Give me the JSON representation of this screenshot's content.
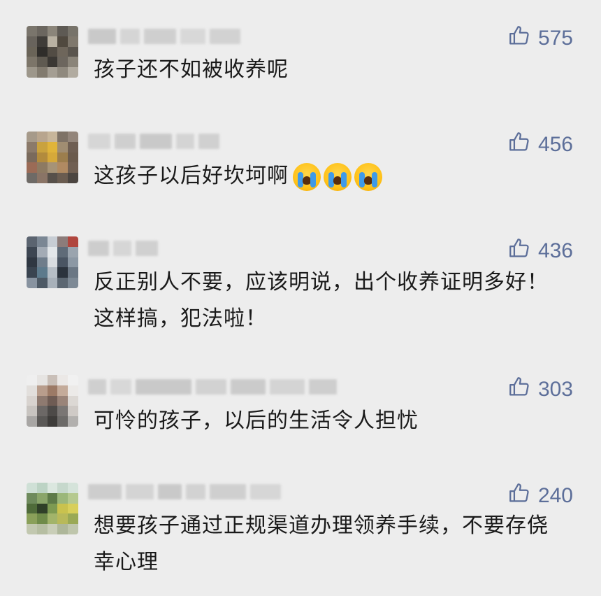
{
  "comments": [
    {
      "likes": "575",
      "text": "孩子还不如被收养呢",
      "emoji_count": 0,
      "avatar_colors": [
        "#7a756c",
        "#6b665f",
        "#8b857a",
        "#5e5a54",
        "#77736a",
        "#68635c",
        "#3f3c38",
        "#b9b1a2",
        "#50493f",
        "#7f786d",
        "#6a6458",
        "#2f2d2a",
        "#524c44",
        "#6e665b",
        "#5a554e",
        "#7c7569",
        "#5f5a51",
        "#3b3834",
        "#6c665e",
        "#8a8479",
        "#9d978b",
        "#827b6f",
        "#a49e93",
        "#8f897e",
        "#b1aba0"
      ],
      "name_blocks": [
        {
          "w": 40,
          "c": "#c9c9c9"
        },
        {
          "w": 28,
          "c": "#d5d5d5"
        },
        {
          "w": 46,
          "c": "#cfcfcf"
        },
        {
          "w": 36,
          "c": "#d8d8d8"
        },
        {
          "w": 44,
          "c": "#d2d2d2"
        }
      ]
    },
    {
      "likes": "456",
      "text": "这孩子以后好坎坷啊",
      "emoji_count": 3,
      "avatar_colors": [
        "#a69a8a",
        "#b8a58e",
        "#c7b59a",
        "#7e7266",
        "#93857a",
        "#8b7a6a",
        "#c9a23e",
        "#e0b43a",
        "#a08d72",
        "#6e5e52",
        "#7a6a5c",
        "#b28b3d",
        "#d6a93a",
        "#9c7e4d",
        "#6a5a4c",
        "#9b6b56",
        "#8d7a62",
        "#a69377",
        "#b08a62",
        "#705f52",
        "#6e6a66",
        "#8a7466",
        "#57504a",
        "#6a5c50",
        "#4b4540"
      ],
      "name_blocks": [
        {
          "w": 32,
          "c": "#d6d6d6"
        },
        {
          "w": 30,
          "c": "#cfcfcf"
        },
        {
          "w": 46,
          "c": "#c9c9c9"
        },
        {
          "w": 26,
          "c": "#d4d4d4"
        },
        {
          "w": 30,
          "c": "#d0d0d0"
        }
      ]
    },
    {
      "likes": "436",
      "text": "反正别人不要，应该明说，出个收养证明多好！这样搞，犯法啦！",
      "emoji_count": 0,
      "avatar_colors": [
        "#5b6470",
        "#7b8794",
        "#c7cdd4",
        "#8c7c7a",
        "#b0463e",
        "#3d4652",
        "#a3abb5",
        "#e3e7ea",
        "#5f6b78",
        "#9aa4ae",
        "#2f3742",
        "#6f7d8b",
        "#d9dde1",
        "#4a5563",
        "#8c98a4",
        "#3a4450",
        "#5d7a8c",
        "#b6bec6",
        "#2b333d",
        "#6b7784",
        "#8893a0",
        "#4d5965",
        "#a8b1ba",
        "#5c6772",
        "#7d8995"
      ],
      "name_blocks": [
        {
          "w": 30,
          "c": "#cdcdcd"
        },
        {
          "w": 26,
          "c": "#d6d6d6"
        },
        {
          "w": 32,
          "c": "#d0d0d0"
        }
      ]
    },
    {
      "likes": "303",
      "text": "可怜的孩子，以后的生活令人担忧",
      "emoji_count": 0,
      "avatar_colors": [
        "#efefef",
        "#e6e4e2",
        "#c9bfb8",
        "#ebe8e6",
        "#f1f1f1",
        "#e2dfdc",
        "#b89d8c",
        "#9c7a66",
        "#c4ab9a",
        "#eceae8",
        "#d8d3cf",
        "#8e7a70",
        "#6f5c54",
        "#9a8479",
        "#dcd8d4",
        "#c8c4c0",
        "#6c6866",
        "#4d4a48",
        "#7a7674",
        "#cfcac6",
        "#a8a6a4",
        "#5a5856",
        "#3e3c3a",
        "#6c6a68",
        "#b2b0ae"
      ],
      "name_blocks": [
        {
          "w": 26,
          "c": "#cfcfcf"
        },
        {
          "w": 30,
          "c": "#d8d8d8"
        },
        {
          "w": 80,
          "c": "#c9c9c9"
        },
        {
          "w": 44,
          "c": "#d2d2d2"
        },
        {
          "w": 50,
          "c": "#cbcbcb"
        },
        {
          "w": 50,
          "c": "#d4d4d4"
        },
        {
          "w": 40,
          "c": "#cecece"
        }
      ]
    },
    {
      "likes": "240",
      "text": "想要孩子通过正规渠道办理领养手续，不要存侥幸心理",
      "emoji_count": 0,
      "avatar_colors": [
        "#cfe0d6",
        "#bcd3c4",
        "#dbe7df",
        "#c6d8cc",
        "#d5e3da",
        "#6e8a5c",
        "#8aa56a",
        "#5d7a48",
        "#9bb77a",
        "#b5c98f",
        "#4f6b3a",
        "#2f3f28",
        "#7d9a52",
        "#c9c24e",
        "#d8cf5a",
        "#8aa05a",
        "#6f8b49",
        "#a2b46a",
        "#b8b95a",
        "#9aa955",
        "#c2c8b0",
        "#b6bea2",
        "#c9ceb8",
        "#aeb79a",
        "#bfc6ac"
      ],
      "name_blocks": [
        {
          "w": 48,
          "c": "#cdcdcd"
        },
        {
          "w": 40,
          "c": "#d4d4d4"
        },
        {
          "w": 34,
          "c": "#c9c9c9"
        },
        {
          "w": 28,
          "c": "#d2d2d2"
        },
        {
          "w": 52,
          "c": "#cfcfcf"
        },
        {
          "w": 44,
          "c": "#d6d6d6"
        }
      ]
    }
  ],
  "icons": {
    "like": "thumbs-up-icon",
    "emoji": "loudly-crying-face-icon"
  },
  "colors": {
    "background": "#ededed",
    "like_count": "#5c6e99",
    "text": "#1a1a1a"
  }
}
